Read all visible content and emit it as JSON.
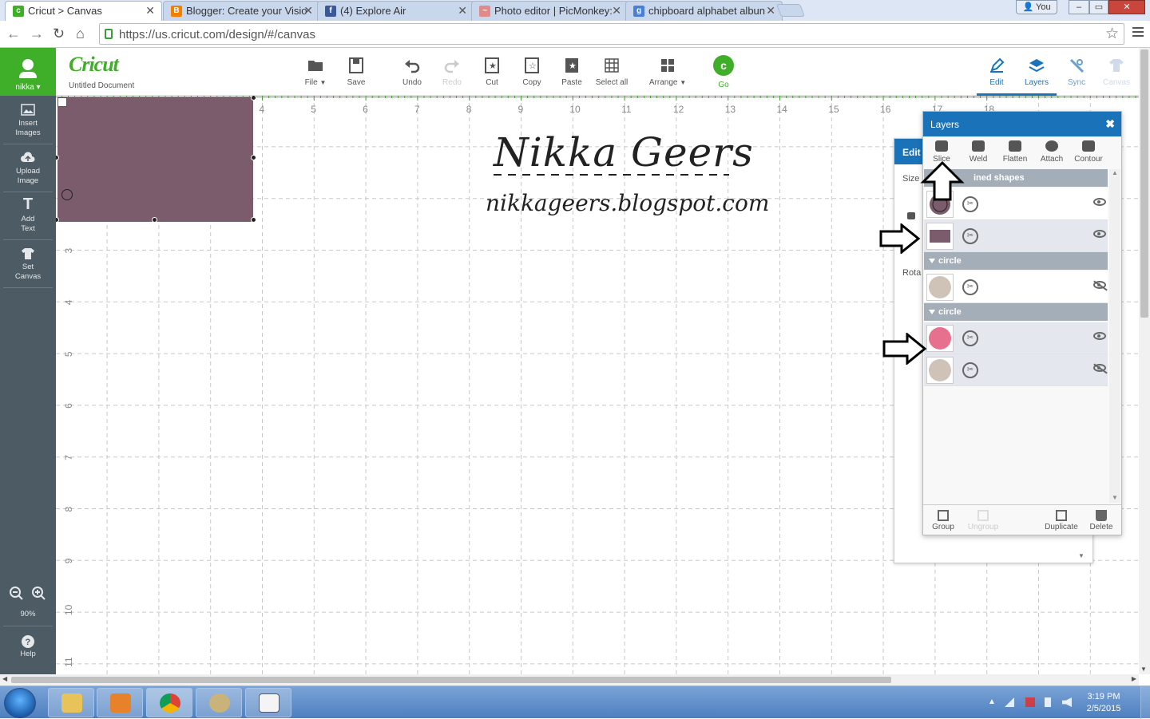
{
  "browser": {
    "tabs": [
      {
        "title": "Cricut > Canvas",
        "icon": "cricut-favicon",
        "active": true
      },
      {
        "title": "Blogger: Create your Visio",
        "icon": "blogger-favicon"
      },
      {
        "title": "(4) Explore Air",
        "icon": "facebook-favicon"
      },
      {
        "title": "Photo editor | PicMonkey:",
        "icon": "picmonkey-favicon"
      },
      {
        "title": "chipboard alphabet albun",
        "icon": "google-favicon"
      }
    ],
    "user_badge": "You",
    "url": "https://us.cricut.com/design/#/canvas",
    "colors": {
      "tab_bar": "#dde6f4",
      "secure_lock": "#3a9d3a"
    }
  },
  "app": {
    "user_name": "nikka",
    "logo": "Cricut",
    "document_name": "Untitled Document",
    "toolbar": [
      {
        "label": "File",
        "icon": "folder-icon",
        "dropdown": true
      },
      {
        "label": "Save",
        "icon": "save-icon"
      },
      {
        "label": "Undo",
        "icon": "undo-icon"
      },
      {
        "label": "Redo",
        "icon": "redo-icon",
        "disabled": true
      },
      {
        "label": "Cut",
        "icon": "cut-icon"
      },
      {
        "label": "Copy",
        "icon": "copy-icon"
      },
      {
        "label": "Paste",
        "icon": "paste-icon"
      },
      {
        "label": "Select all",
        "icon": "select-all-icon"
      },
      {
        "label": "Arrange",
        "icon": "arrange-icon",
        "dropdown": true
      }
    ],
    "go_label": "Go",
    "right_tabs": [
      {
        "label": "Edit",
        "icon": "pencil-icon",
        "active": false
      },
      {
        "label": "Layers",
        "icon": "layers-icon",
        "active": true
      },
      {
        "label": "Sync",
        "icon": "sync-icon"
      },
      {
        "label": "Canvas",
        "icon": "shirt-icon",
        "disabled": true
      }
    ],
    "colors": {
      "brand_green": "#3fae29",
      "accent_blue": "#1a73b8",
      "sidebar": "#4d5b64"
    }
  },
  "sidebar": {
    "items": [
      {
        "line1": "Insert",
        "line2": "Images",
        "icon": "image-icon"
      },
      {
        "line1": "Upload",
        "line2": "Image",
        "icon": "upload-cloud-icon"
      },
      {
        "line1": "Add",
        "line2": "Text",
        "icon": "text-icon"
      },
      {
        "line1": "Set",
        "line2": "Canvas",
        "icon": "shirt-icon"
      }
    ],
    "zoom": "90%",
    "help": "Help"
  },
  "canvas": {
    "ruler_top": [
      "4",
      "5",
      "6",
      "7",
      "8",
      "9",
      "10",
      "11",
      "12",
      "13",
      "14",
      "15",
      "16",
      "17",
      "18"
    ],
    "ruler_left": [
      "3",
      "4",
      "5",
      "6",
      "7",
      "8",
      "9",
      "10",
      "11"
    ],
    "watermark_name": "Nikka Geers",
    "watermark_url": "nikkageers.blogspot.com",
    "shape_color": "#7b5c6c"
  },
  "edit_panel": {
    "title": "Edit",
    "size_label": "Size",
    "rotate_label": "Rota"
  },
  "layers_panel": {
    "title": "Layers",
    "tools": [
      {
        "label": "Slice",
        "icon": "slice-icon"
      },
      {
        "label": "Weld",
        "icon": "weld-icon"
      },
      {
        "label": "Flatten",
        "icon": "flatten-icon"
      },
      {
        "label": "Attach",
        "icon": "attach-icon"
      },
      {
        "label": "Contour",
        "icon": "contour-icon"
      }
    ],
    "groups": [
      {
        "name": "ined shapes",
        "layers": [
          {
            "thumb": "circle-outline",
            "color": "#7b5c6c",
            "visible": true
          },
          {
            "thumb": "rectangle",
            "color": "#7b5c6c",
            "visible": true
          }
        ]
      },
      {
        "name": "circle",
        "layers": [
          {
            "thumb": "circle",
            "color": "#cfc3b8",
            "visible": false
          }
        ]
      },
      {
        "name": "circle",
        "layers": [
          {
            "thumb": "circle",
            "color": "#e8708f",
            "visible": true
          },
          {
            "thumb": "circle",
            "color": "#cfc3b8",
            "visible": false
          }
        ]
      }
    ],
    "bottom_tools": [
      {
        "label": "Group",
        "disabled": false
      },
      {
        "label": "Ungroup",
        "disabled": true
      },
      {
        "label": "Duplicate",
        "disabled": false
      },
      {
        "label": "Delete",
        "disabled": false
      }
    ]
  },
  "taskbar": {
    "time": "3:19 PM",
    "date": "2/5/2015",
    "apps": [
      "file-explorer-icon",
      "media-player-icon",
      "chrome-icon",
      "paint-icon",
      "wordpad-icon"
    ]
  }
}
